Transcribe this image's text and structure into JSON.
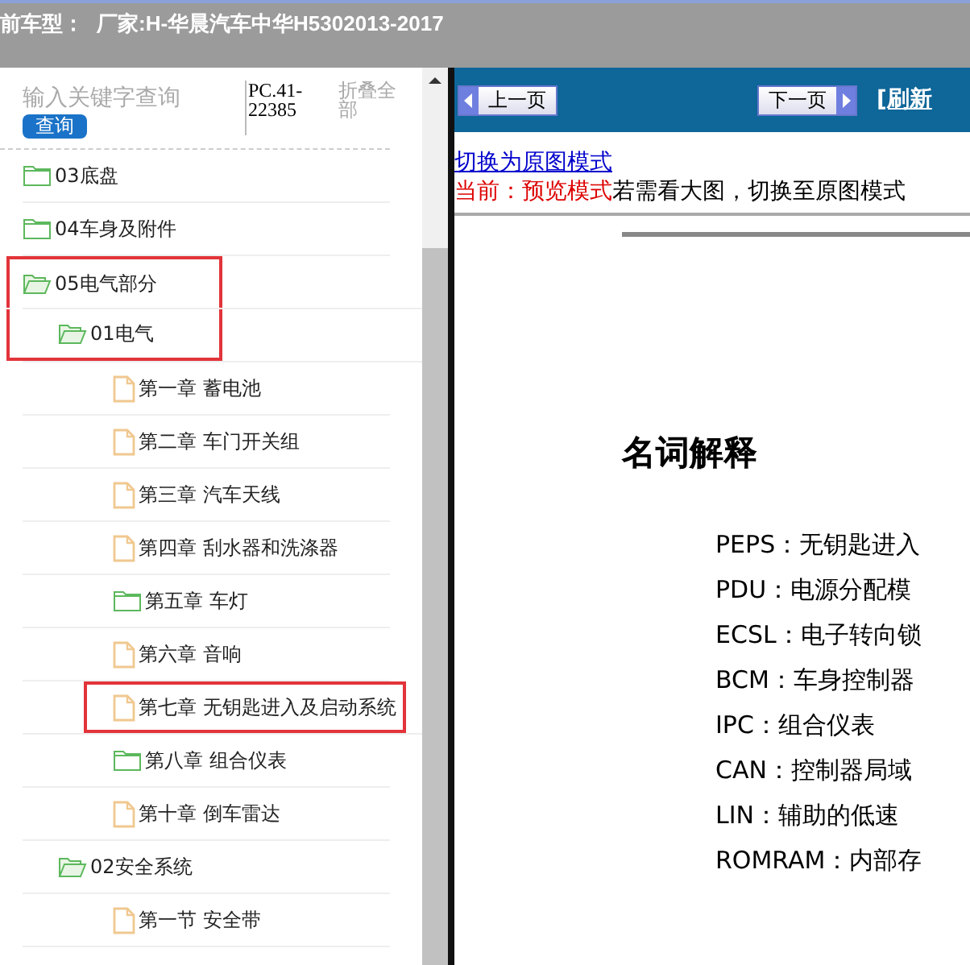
{
  "title_bar": {
    "label": "前车型：",
    "value": "厂家:H-华晨汽车中华H5302013-2017"
  },
  "sidebar": {
    "search": {
      "placeholder": "输入关键字查询",
      "button": "查询"
    },
    "code": "PC.41-22385",
    "collapse_all": "折叠全部",
    "tree": [
      {
        "label": "03底盘",
        "kind": "folder",
        "expanded": false,
        "marked": false
      },
      {
        "label": "04车身及附件",
        "kind": "folder",
        "expanded": false,
        "marked": false
      },
      {
        "label": "05电气部分",
        "kind": "folder",
        "expanded": true,
        "marked": true,
        "children": [
          {
            "label": "01电气",
            "kind": "folder",
            "expanded": true,
            "marked": true,
            "children": [
              {
                "label": "第一章 蓄电池",
                "kind": "file",
                "marked": false
              },
              {
                "label": "第二章 车门开关组",
                "kind": "file",
                "marked": false
              },
              {
                "label": "第三章 汽车天线",
                "kind": "file",
                "marked": false
              },
              {
                "label": "第四章 刮水器和洗涤器",
                "kind": "file",
                "marked": false
              },
              {
                "label": "第五章 车灯",
                "kind": "folder",
                "expanded": false,
                "marked": false
              },
              {
                "label": "第六章 音响",
                "kind": "file",
                "marked": false
              },
              {
                "label": "第七章 无钥匙进入及启动系统",
                "kind": "file",
                "marked": true
              },
              {
                "label": "第八章 组合仪表",
                "kind": "folder",
                "expanded": false,
                "marked": false
              },
              {
                "label": "第十章 倒车雷达",
                "kind": "file",
                "marked": false
              }
            ]
          },
          {
            "label": "02安全系统",
            "kind": "folder",
            "expanded": true,
            "marked": false,
            "children": [
              {
                "label": "第一节 安全带",
                "kind": "file",
                "marked": false
              }
            ]
          }
        ]
      }
    ]
  },
  "viewer": {
    "prev_button": "上一页",
    "next_button": "下一页",
    "refresh_link": "[刷新",
    "switch_link": "切换为原图模式",
    "mode_label": "当前：预览模式",
    "mode_hint": "若需看大图，切换至原图模式",
    "document": {
      "heading": "名词解释",
      "terms": [
        "PEPS：无钥匙进入",
        "PDU：电源分配模",
        "ECSL：电子转向锁",
        "BCM：车身控制器",
        "IPC：组合仪表",
        "CAN：控制器局域",
        "LIN：辅助的低速",
        "ROMRAM：内部存"
      ]
    }
  }
}
